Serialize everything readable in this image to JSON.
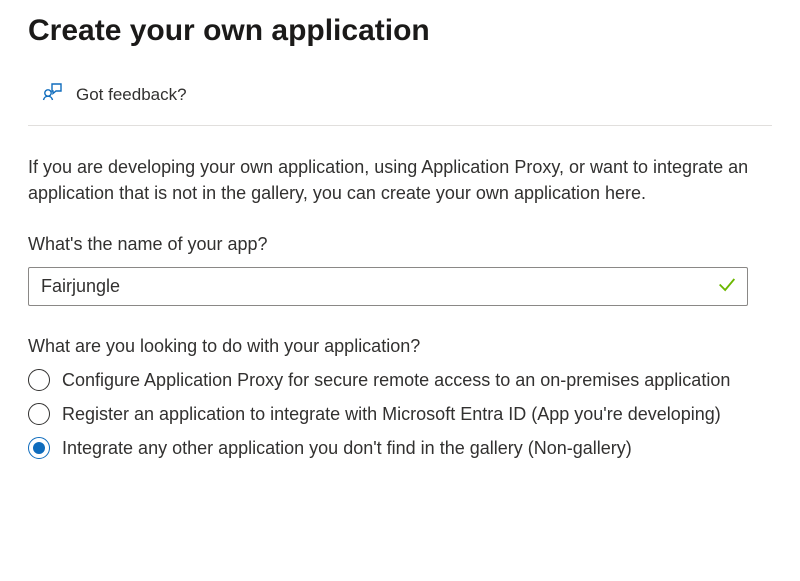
{
  "title": "Create your own application",
  "feedback": {
    "label": "Got feedback?"
  },
  "description": {
    "line1": "If you are developing your own application, using Application Proxy, or want to integrate an",
    "line2": "application that is not in the gallery, you can create your own application here."
  },
  "name_field": {
    "label": "What's the name of your app?",
    "value": "Fairjungle",
    "valid": true
  },
  "purpose": {
    "label": "What are you looking to do with your application?",
    "selected_index": 2,
    "options": [
      "Configure Application Proxy for secure remote access to an on-premises application",
      "Register an application to integrate with Microsoft Entra ID (App you're developing)",
      "Integrate any other application you don't find in the gallery (Non-gallery)"
    ]
  }
}
